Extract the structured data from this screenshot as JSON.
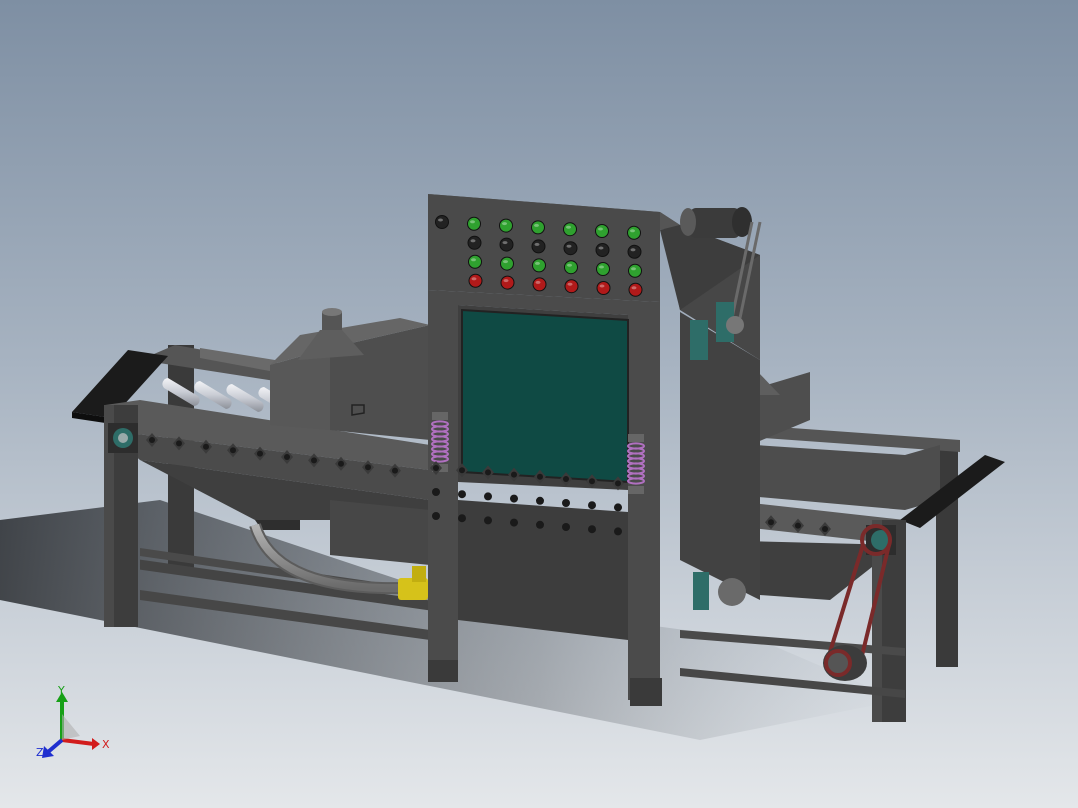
{
  "scene": {
    "description_free": true,
    "panel": {
      "button_rows": [
        [
          "dark",
          "green",
          "green",
          "green",
          "green",
          "green",
          "green"
        ],
        [
          "none",
          "dark",
          "dark",
          "dark",
          "dark",
          "dark",
          "dark"
        ],
        [
          "none",
          "green",
          "green",
          "green",
          "green",
          "green",
          "green"
        ],
        [
          "none",
          "red",
          "red",
          "red",
          "red",
          "red",
          "red"
        ]
      ]
    },
    "colors": {
      "body": "#4a4a4a",
      "body_light": "#5c5c5c",
      "body_dark": "#383838",
      "window": "#0f4a44",
      "roller": "#d4d6dc",
      "green": "#2fa12f",
      "red": "#b11a1a",
      "spring": "#b070c0",
      "pipe": "#8a8a8a",
      "pipe_fitting": "#d6c21a",
      "belt": "#7a2a2a",
      "bearing": "#2e6d68"
    }
  },
  "triad": {
    "x_label": "X",
    "y_label": "Y",
    "z_label": "Z",
    "x_color": "#d21c1c",
    "y_color": "#17a017",
    "z_color": "#1f2fcf"
  }
}
